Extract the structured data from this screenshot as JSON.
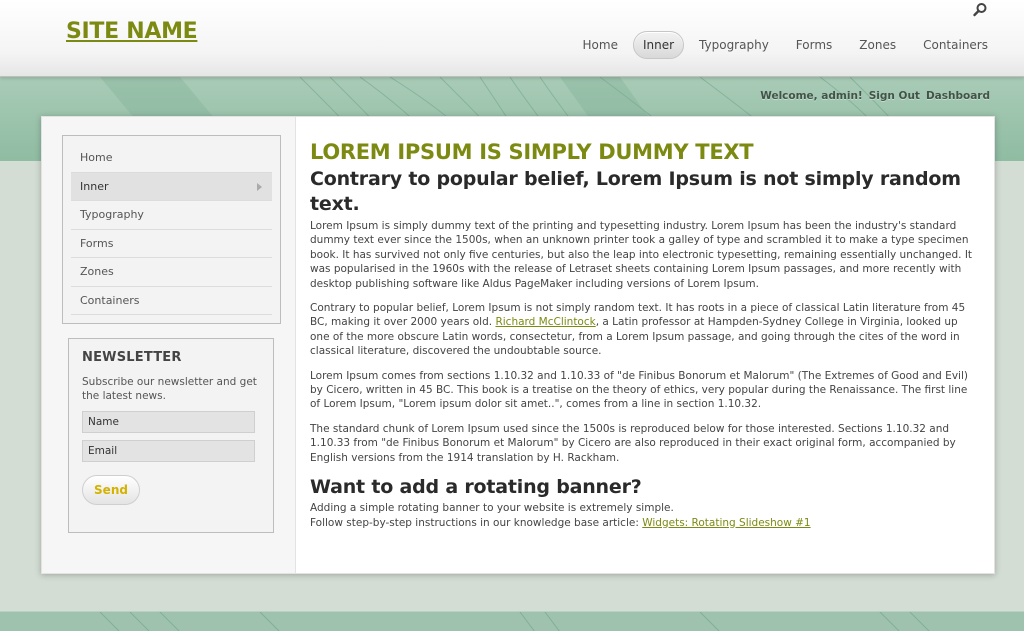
{
  "header": {
    "site_name": "SITE NAME",
    "search_icon": "search-icon",
    "nav": [
      "Home",
      "Inner",
      "Typography",
      "Forms",
      "Zones",
      "Containers"
    ],
    "active_nav": "Inner"
  },
  "user_bar": {
    "welcome": "Welcome, admin!",
    "sign_out": "Sign Out",
    "dashboard": "Dashboard"
  },
  "sidebar": {
    "items": [
      "Home",
      "Inner",
      "Typography",
      "Forms",
      "Zones",
      "Containers"
    ],
    "active": "Inner"
  },
  "newsletter": {
    "title": "NEWSLETTER",
    "description": "Subscribe our newsletter and get the latest news.",
    "name_placeholder": "Name",
    "email_placeholder": "Email",
    "send_label": "Send"
  },
  "content": {
    "title": "LOREM IPSUM IS SIMPLY DUMMY TEXT",
    "subtitle": "Contrary to popular belief, Lorem Ipsum is not simply random text.",
    "p1": "Lorem Ipsum is simply dummy text of the printing and typesetting industry. Lorem Ipsum has been the industry's standard dummy text ever since the 1500s, when an unknown printer took a galley of type and scrambled it to make a type specimen book. It has survived not only five centuries, but also the leap into electronic typesetting, remaining essentially unchanged. It was popularised in the 1960s with the release of Letraset sheets containing Lorem Ipsum passages, and more recently with desktop publishing software like Aldus PageMaker including versions of Lorem Ipsum.",
    "p2_before": "Contrary to popular belief, Lorem Ipsum is not simply random text. It has roots in a piece of classical Latin literature from 45 BC, making it over 2000 years old. ",
    "p2_link": "Richard McClintock",
    "p2_after": ", a Latin professor at Hampden-Sydney College in Virginia, looked up one of the more obscure Latin words, consectetur, from a Lorem Ipsum passage, and going through the cites of the word in classical literature, discovered the undoubtable source.",
    "p3": "Lorem Ipsum comes from sections 1.10.32 and 1.10.33 of \"de Finibus Bonorum et Malorum\" (The Extremes of Good and Evil) by Cicero, written in 45 BC. This book is a treatise on the theory of ethics, very popular during the Renaissance. The first line of Lorem Ipsum, \"Lorem ipsum dolor sit amet..\", comes from a line in section 1.10.32.",
    "p4": "The standard chunk of Lorem Ipsum used since the 1500s is reproduced below for those interested. Sections 1.10.32 and 1.10.33 from \"de Finibus Bonorum et Malorum\" by Cicero are also reproduced in their exact original form, accompanied by English versions from the 1914 translation by H. Rackham.",
    "banner_title": "Want to add a rotating banner?",
    "banner_line1": "Adding a simple rotating banner to your website is extremely simple.",
    "banner_line2_before": "Follow step-by-step instructions in our knowledge base article: ",
    "banner_link": "Widgets: Rotating Slideshow #1"
  },
  "colors": {
    "accent": "#7d8a12",
    "band": "#8fbca2",
    "send": "#d4b300"
  }
}
